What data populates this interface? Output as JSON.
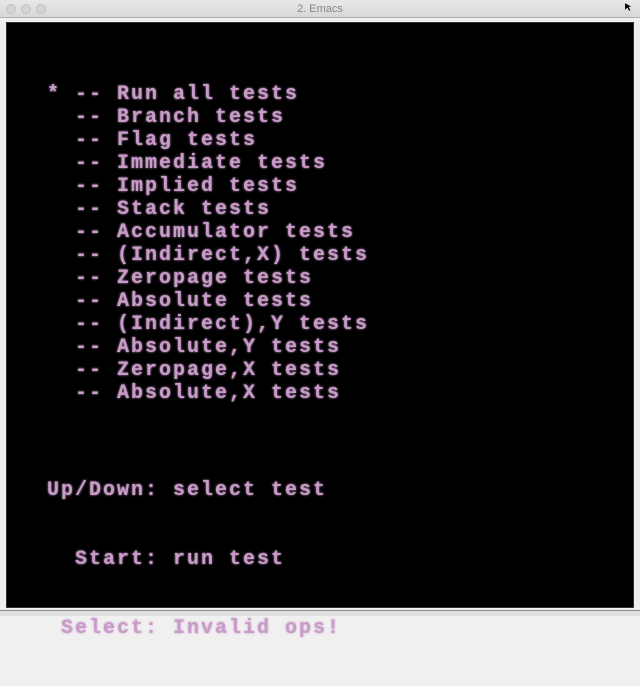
{
  "window": {
    "title": "2. Emacs"
  },
  "menu": {
    "cursor_prefix": "*",
    "item_prefix": "--",
    "items": [
      "Run all tests",
      "Branch tests",
      "Flag tests",
      "Immediate tests",
      "Implied tests",
      "Stack tests",
      "Accumulator tests",
      "(Indirect,X) tests",
      "Zeropage tests",
      "Absolute tests",
      "(Indirect),Y tests",
      "Absolute,Y tests",
      "Zeropage,X tests",
      "Absolute,X tests"
    ],
    "selected_index": 0
  },
  "instructions": {
    "line1": "Up/Down: select test",
    "line2": "  Start: run test",
    "line3": " Select: Invalid ops!"
  },
  "colors": {
    "background": "#000000",
    "text": "#c89bc8"
  }
}
